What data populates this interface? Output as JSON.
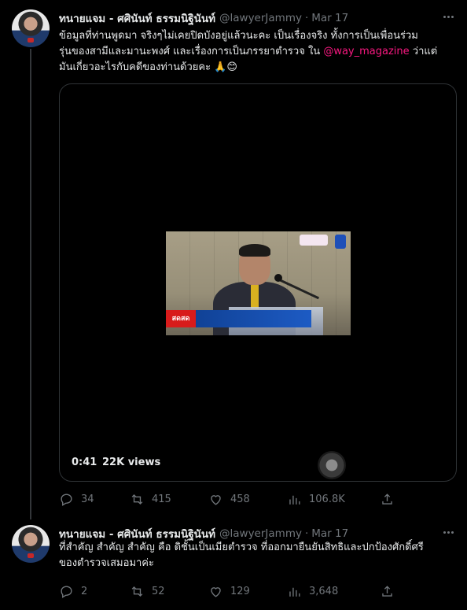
{
  "tweets": [
    {
      "author": {
        "display_name": "ทนายแจม - ศศินันท์ ธรรมนิฐินันท์",
        "handle": "@lawyerJammy",
        "date": "Mar 17"
      },
      "text": {
        "line1": "ข้อมูลที่ท่านพูดมา จริงๆไม่เคยปิดบังอยู่แล้วนะคะ เป็นเรื่องจริง ทั้งการเป็นเพื่อนร่วม",
        "line2_a": "รุ่นของสามีและมานะพงศ์  และเรื่องการเป็นภรรยาตำรวจ ใน ",
        "mention": "@way_magazine",
        "line2_b": " ว่าแต่",
        "line3": "มันเกี่ยวอะไรกับคดีของท่านด้วยคะ 🙏😊"
      },
      "media": {
        "duration": "0:41",
        "views": "22K views",
        "ticker_label": "สดสด"
      },
      "actions": {
        "replies": "34",
        "retweets": "415",
        "likes": "458",
        "views": "106.8K"
      }
    },
    {
      "author": {
        "display_name": "ทนายแจม - ศศินันท์ ธรรมนิฐินันท์",
        "handle": "@lawyerJammy",
        "date": "Mar 17"
      },
      "text": {
        "line1": "ที่สำคัญ สำคัญ สำคัญ คือ ดิชั้นเป็นเมียตำรวจ ที่ออกมายืนยันสิทธิและปกป้องศักดิ์ศรี",
        "line2": "ของตำรวจเสมอมาค่ะ"
      },
      "actions": {
        "replies": "2",
        "retweets": "52",
        "likes": "129",
        "views": "3,648"
      }
    }
  ],
  "colors": {
    "background": "#000000",
    "text": "#e7e9ea",
    "muted": "#71767b",
    "mention": "#f91880",
    "border": "#2f3336"
  },
  "icons": [
    "more-icon",
    "reply-icon",
    "retweet-icon",
    "like-icon",
    "views-icon",
    "share-icon"
  ]
}
